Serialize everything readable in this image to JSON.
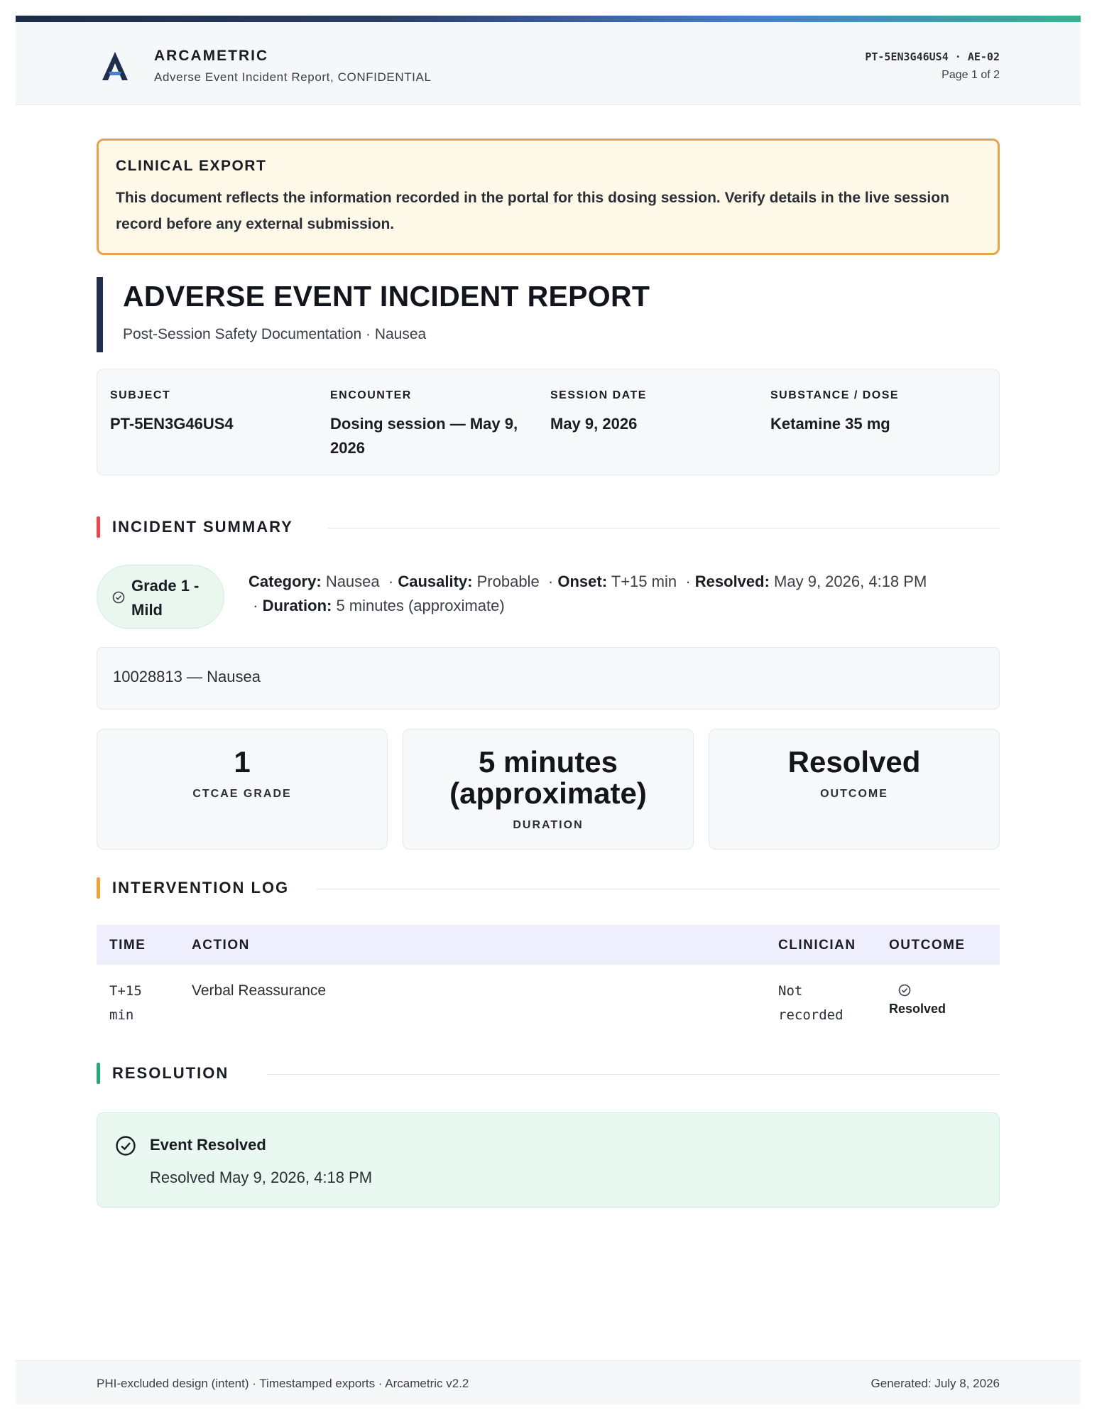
{
  "header": {
    "brand": "ARCAMETRIC",
    "subtitle": "Adverse Event Incident Report, CONFIDENTIAL",
    "doc_id": "PT-5EN3G46US4 · AE-02",
    "page": "Page 1 of 2"
  },
  "notice": {
    "title": "CLINICAL EXPORT",
    "body": "This document reflects the information recorded in the portal for this dosing session. Verify details in the live session record before any external submission."
  },
  "report": {
    "title": "ADVERSE EVENT INCIDENT REPORT",
    "subtitle": "Post-Session Safety Documentation · Nausea"
  },
  "meta": [
    {
      "label": "SUBJECT",
      "value": "PT-5EN3G46US4"
    },
    {
      "label": "ENCOUNTER",
      "value": "Dosing session — May 9, 2026"
    },
    {
      "label": "SESSION DATE",
      "value": "May 9, 2026"
    },
    {
      "label": "SUBSTANCE / DOSE",
      "value": "Ketamine 35 mg"
    }
  ],
  "sections": {
    "summary": "INCIDENT SUMMARY",
    "intervention": "INTERVENTION LOG",
    "resolution": "RESOLUTION"
  },
  "summary": {
    "grade_badge": "Grade 1 - Mild",
    "category_label": "Category:",
    "category": "Nausea",
    "causality_label": "Causality:",
    "causality": "Probable",
    "onset_label": "Onset:",
    "onset": "T+15 min",
    "resolved_label": "Resolved:",
    "resolved": "May 9, 2026, 4:18 PM",
    "duration_label": "Duration:",
    "duration": "5 minutes (approximate)",
    "code": "10028813 — Nausea"
  },
  "stats": [
    {
      "value": "1",
      "label": "CTCAE GRADE"
    },
    {
      "value": "5 minutes (approximate)",
      "label": "DURATION"
    },
    {
      "value": "Resolved",
      "label": "OUTCOME"
    }
  ],
  "intervention_table": {
    "columns": [
      "TIME",
      "ACTION",
      "CLINICIAN",
      "OUTCOME"
    ],
    "rows": [
      {
        "time": "T+15 min",
        "action": "Verbal Reassurance",
        "clinician": "Not recorded",
        "outcome": "Resolved"
      }
    ]
  },
  "resolution": {
    "title": "Event Resolved",
    "body": "Resolved May 9, 2026, 4:18 PM"
  },
  "footer": {
    "left": "PHI-excluded design (intent) · Timestamped exports · Arcametric v2.2",
    "right": "Generated: July 8, 2026"
  },
  "colors": {
    "summary_bar": "#e5484d",
    "intervention_bar": "#f0a23b",
    "resolution_bar": "#2fa37a",
    "title_bar": "#1e2e4c",
    "notice_border": "#e6a34e",
    "success": "#2fa37a"
  },
  "icons": {
    "logo": "arcametric-logo",
    "check": "check-circle-icon"
  }
}
